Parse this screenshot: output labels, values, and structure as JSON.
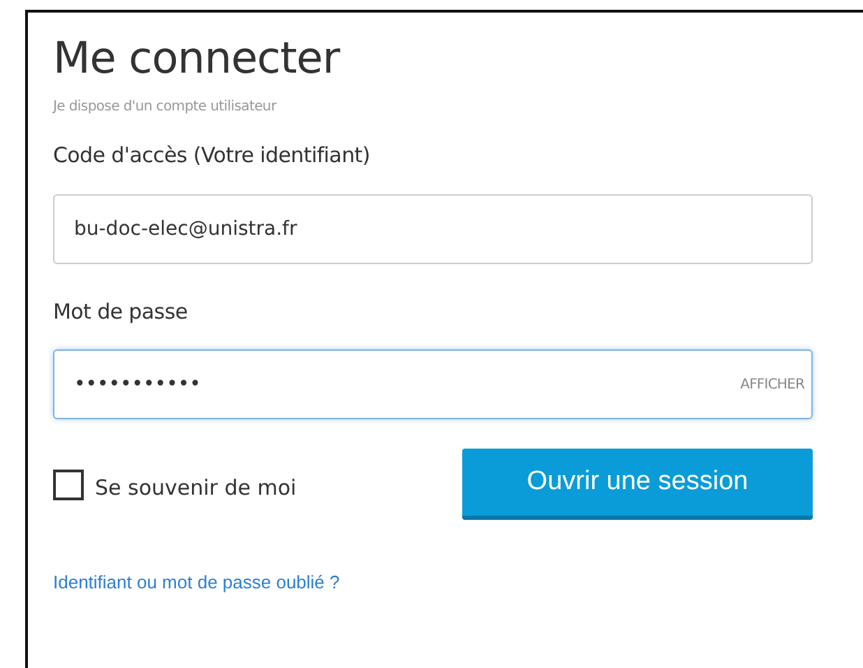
{
  "title": "Me connecter",
  "subtitle": "Je dispose d'un compte utilisateur",
  "fields": [
    {
      "label": "Code d'accès (Votre identifiant)",
      "value": "bu-doc-elec@unistra.fr",
      "focused": false
    },
    {
      "label": "Mot de passe",
      "value": "•••••••••••",
      "focused": true,
      "action": "AFFICHER"
    }
  ],
  "remember": {
    "label": "Se souvenir de moi",
    "checked": false
  },
  "submit": "Ouvrir une session",
  "forgot_link": "Identifiant ou mot de passe oublié ?"
}
